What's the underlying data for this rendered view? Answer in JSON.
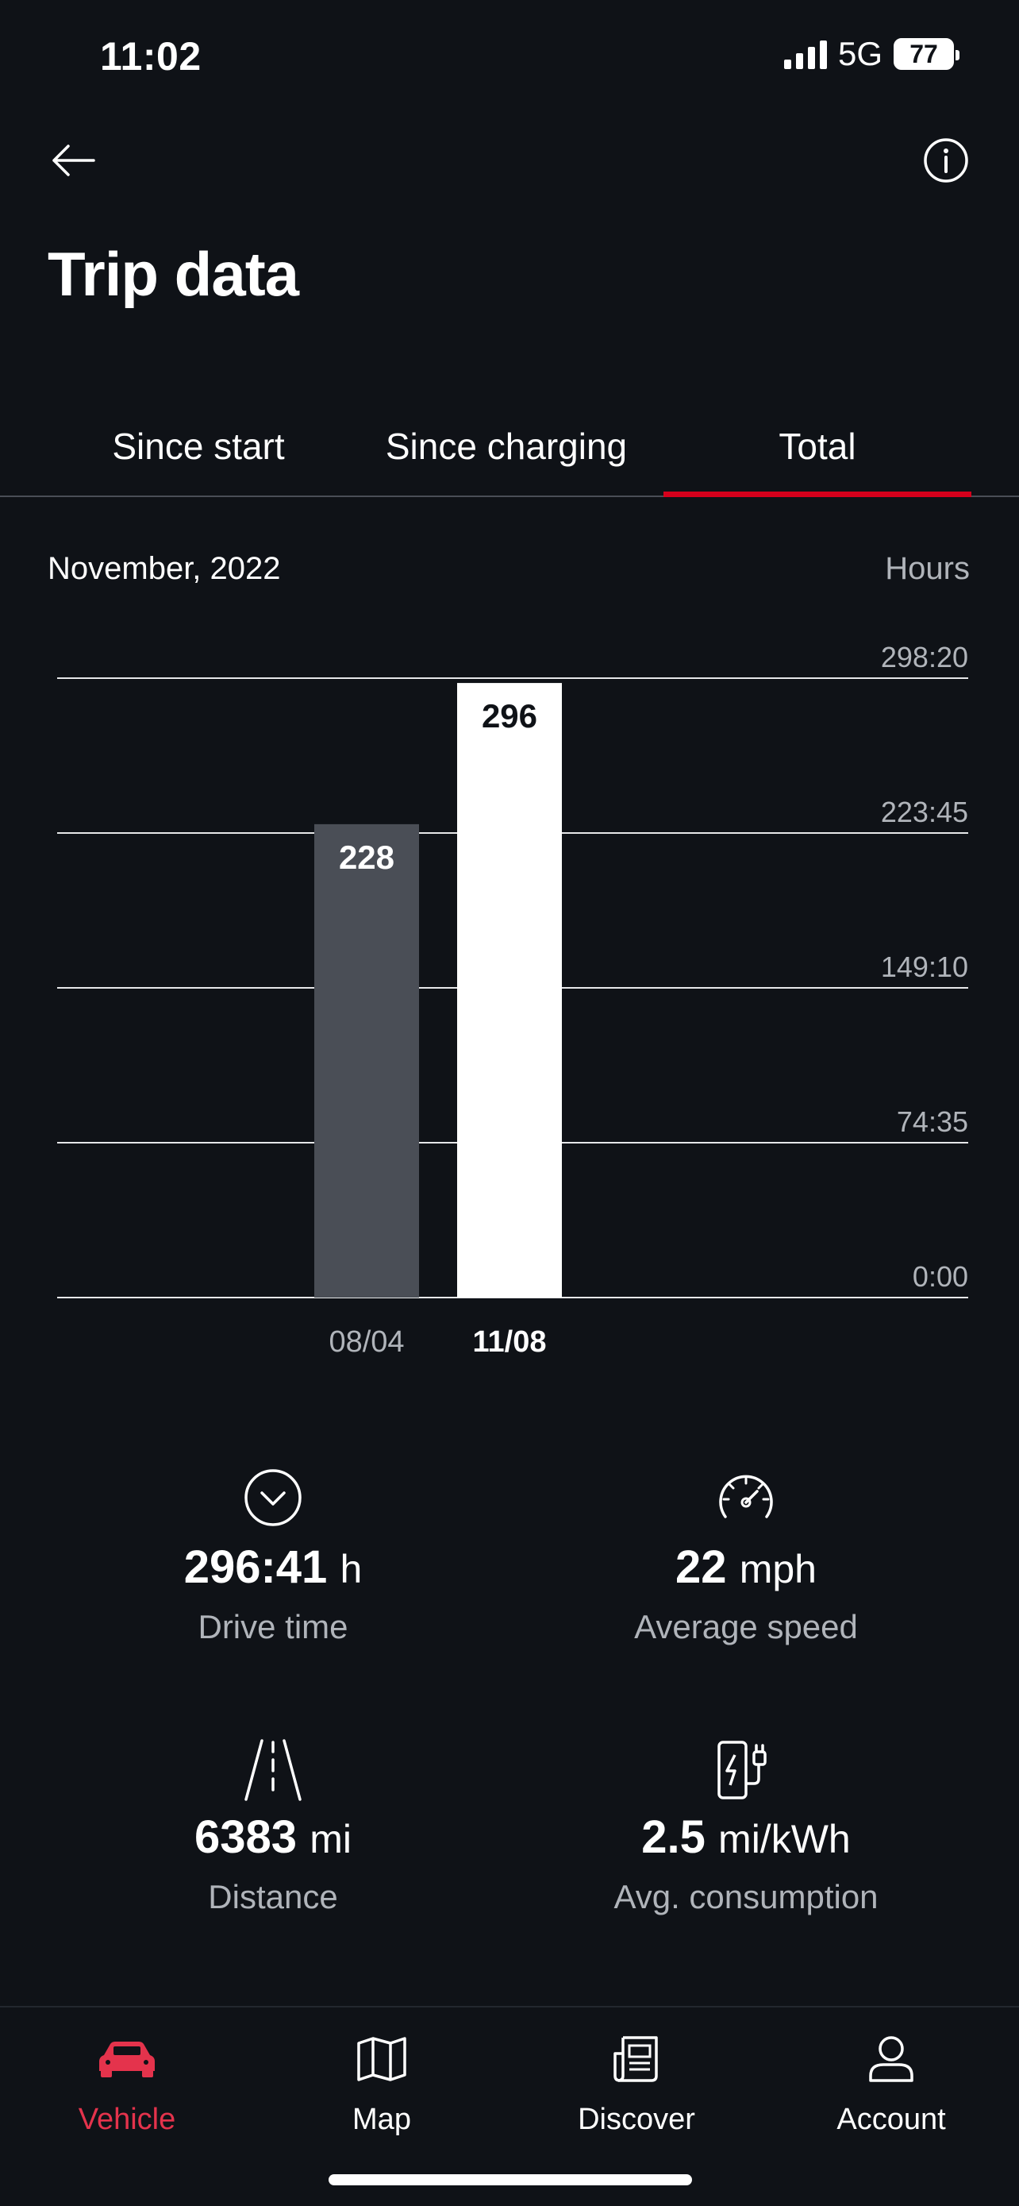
{
  "status_bar": {
    "time": "11:02",
    "network": "5G",
    "battery": "77"
  },
  "header": {
    "back_icon": "arrow-left-icon",
    "info_icon": "info-icon",
    "title": "Trip data"
  },
  "tabs": [
    {
      "label": "Since start",
      "active": false
    },
    {
      "label": "Since charging",
      "active": false
    },
    {
      "label": "Total",
      "active": true
    }
  ],
  "chart_header": {
    "month": "November, 2022",
    "unit": "Hours"
  },
  "chart_data": {
    "type": "bar",
    "categories": [
      "08/04",
      "11/08"
    ],
    "values": [
      228,
      296
    ],
    "data_labels": [
      "228",
      "296"
    ],
    "bar_colors": [
      "#4a4e56",
      "#ffffff"
    ],
    "label_colors": [
      "#ffffff",
      "#0f1217"
    ],
    "ylabel": "Hours",
    "y_tick_labels": [
      "298:20",
      "223:45",
      "149:10",
      "74:35",
      "0:00"
    ],
    "y_tick_values": [
      298.33,
      223.75,
      149.17,
      74.58,
      0
    ],
    "ylim": [
      0,
      298.33
    ],
    "grid": true,
    "selected_category": "11/08"
  },
  "stats": [
    {
      "icon": "chevron-down-circle-icon",
      "value": "296:41",
      "unit": "h",
      "label": "Drive time"
    },
    {
      "icon": "speedometer-icon",
      "value": "22",
      "unit": "mph",
      "label": "Average speed"
    },
    {
      "icon": "road-icon",
      "value": "6383",
      "unit": "mi",
      "label": "Distance"
    },
    {
      "icon": "charging-station-icon",
      "value": "2.5",
      "unit": "mi/kWh",
      "label": "Avg. consumption"
    }
  ],
  "bottom_nav": [
    {
      "icon": "car-icon",
      "label": "Vehicle",
      "active": true
    },
    {
      "icon": "map-icon",
      "label": "Map",
      "active": false
    },
    {
      "icon": "newspaper-icon",
      "label": "Discover",
      "active": false
    },
    {
      "icon": "person-icon",
      "label": "Account",
      "active": false
    }
  ],
  "colors": {
    "background": "#0f1217",
    "accent": "#d5001c",
    "muted_text": "#b0b4ba"
  }
}
